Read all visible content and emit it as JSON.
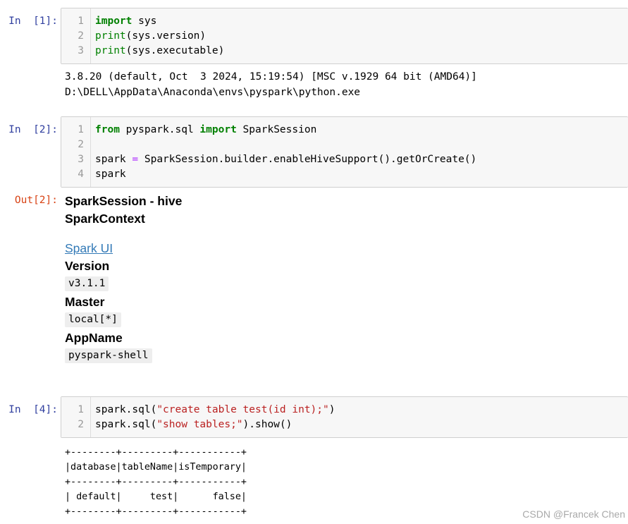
{
  "cells": [
    {
      "prompt": "In  [1]:",
      "lines": [
        {
          "n": "1",
          "tokens": [
            {
              "t": "import",
              "c": "kw"
            },
            {
              "t": " sys",
              "c": ""
            }
          ]
        },
        {
          "n": "2",
          "tokens": [
            {
              "t": "print",
              "c": "bi"
            },
            {
              "t": "(sys.version)",
              "c": ""
            }
          ]
        },
        {
          "n": "3",
          "tokens": [
            {
              "t": "print",
              "c": "bi"
            },
            {
              "t": "(sys.executable)",
              "c": ""
            }
          ]
        }
      ],
      "output": [
        "3.8.20 (default, Oct  3 2024, 15:19:54) [MSC v.1929 64 bit (AMD64)]",
        "D:\\DELL\\AppData\\Anaconda\\envs\\pyspark\\python.exe"
      ]
    },
    {
      "prompt": "In  [2]:",
      "out_prompt": "Out[2]:",
      "lines": [
        {
          "n": "1",
          "tokens": [
            {
              "t": "from",
              "c": "kw"
            },
            {
              "t": " pyspark.sql ",
              "c": ""
            },
            {
              "t": "import",
              "c": "kw"
            },
            {
              "t": " SparkSession",
              "c": ""
            }
          ]
        },
        {
          "n": "2",
          "tokens": []
        },
        {
          "n": "3",
          "tokens": [
            {
              "t": "spark ",
              "c": ""
            },
            {
              "t": "=",
              "c": "op"
            },
            {
              "t": " SparkSession.builder.enableHiveSupport().getOrCreate()",
              "c": ""
            }
          ]
        },
        {
          "n": "4",
          "tokens": [
            {
              "t": "spark",
              "c": ""
            }
          ]
        }
      ],
      "html_output": {
        "session_title": "SparkSession - hive",
        "context_title": "SparkContext",
        "spark_ui_link": "Spark UI",
        "version_label": "Version",
        "version_value": "v3.1.1",
        "master_label": "Master",
        "master_value": "local[*]",
        "appname_label": "AppName",
        "appname_value": "pyspark-shell"
      }
    },
    {
      "prompt": "In  [4]:",
      "lines": [
        {
          "n": "1",
          "tokens": [
            {
              "t": "spark.sql(",
              "c": ""
            },
            {
              "t": "\"create table test(id int);\"",
              "c": "st"
            },
            {
              "t": ")",
              "c": ""
            }
          ]
        },
        {
          "n": "2",
          "tokens": [
            {
              "t": "spark.sql(",
              "c": ""
            },
            {
              "t": "\"show tables;\"",
              "c": "st"
            },
            {
              "t": ").show()",
              "c": ""
            }
          ]
        }
      ],
      "table_output": [
        "+--------+---------+-----------+",
        "|database|tableName|isTemporary|",
        "+--------+---------+-----------+",
        "| default|     test|      false|",
        "+--------+---------+-----------+"
      ]
    }
  ],
  "watermark": "CSDN @Francek Chen"
}
